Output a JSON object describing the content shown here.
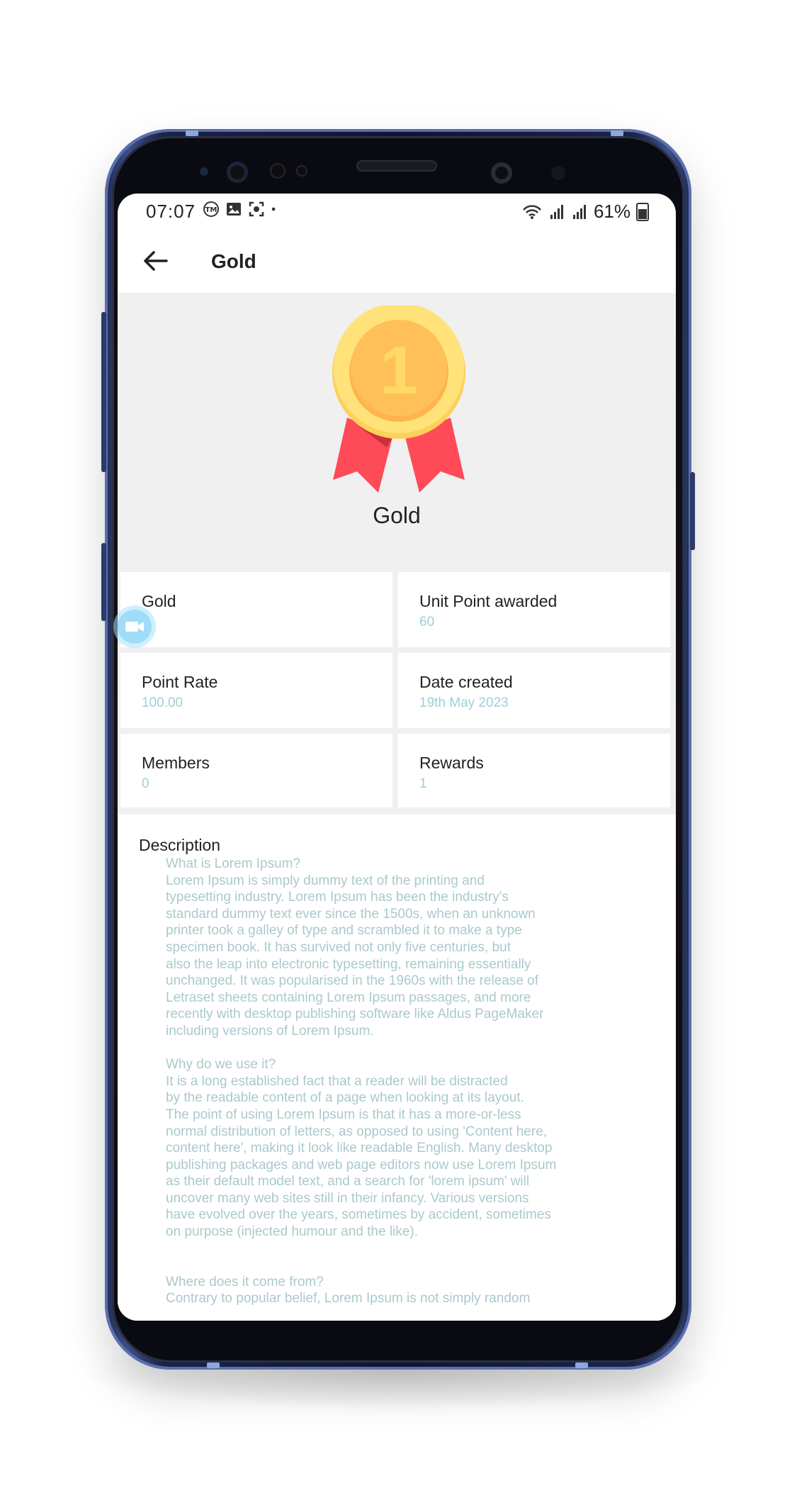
{
  "status_bar": {
    "time": "07:07",
    "battery": "61%",
    "left_icons": [
      "tm-icon",
      "image-icon",
      "screenshot-icon",
      "dot-icon"
    ],
    "right_icons": [
      "wifi-icon",
      "signal-icon",
      "signal-icon",
      "battery-icon"
    ]
  },
  "appbar": {
    "title": "Gold",
    "back_icon": "arrow-left-icon"
  },
  "hero": {
    "title": "Gold",
    "medal_number": "1",
    "colors": {
      "medal_outer": "#ffd966",
      "medal_inner": "#ffb84d",
      "ribbon": "#ff4a57"
    }
  },
  "details": [
    {
      "label": "Gold",
      "value": ""
    },
    {
      "label": "Unit Point awarded",
      "value": "60"
    },
    {
      "label": "Point Rate",
      "value": "100.00"
    },
    {
      "label": "Date created",
      "value": "19th May 2023"
    },
    {
      "label": "Members",
      "value": "0"
    },
    {
      "label": "Rewards",
      "value": "1"
    }
  ],
  "description": {
    "title": "Description",
    "body": "What is Lorem Ipsum?\nLorem Ipsum is simply dummy text of the printing and\ntypesetting industry. Lorem Ipsum has been the industry's\nstandard dummy text ever since the 1500s, when an unknown\nprinter took a galley of type and scrambled it to make a type\nspecimen book. It has survived not only five centuries, but\nalso the leap into electronic typesetting, remaining essentially\nunchanged. It was popularised in the 1960s with the release of\nLetraset sheets containing Lorem Ipsum passages, and more\nrecently with desktop publishing software like Aldus PageMaker\nincluding versions of Lorem Ipsum.\n\nWhy do we use it?\nIt is a long established fact that a reader will be distracted\nby the readable content of a page when looking at its layout.\nThe point of using Lorem Ipsum is that it has a more-or-less\nnormal distribution of letters, as opposed to using 'Content here,\ncontent here', making it look like readable English. Many desktop\npublishing packages and web page editors now use Lorem Ipsum\nas their default model text, and a search for 'lorem ipsum' will\nuncover many web sites still in their infancy. Various versions\nhave evolved over the years, sometimes by accident, sometimes\non purpose (injected humour and the like).\n\n\nWhere does it come from?\nContrary to popular belief, Lorem Ipsum is not simply random"
  },
  "colors": {
    "accent_value_text": "#9ecfd5",
    "background_gray": "#f0f0f0",
    "phone_frame": "#1a2346"
  }
}
